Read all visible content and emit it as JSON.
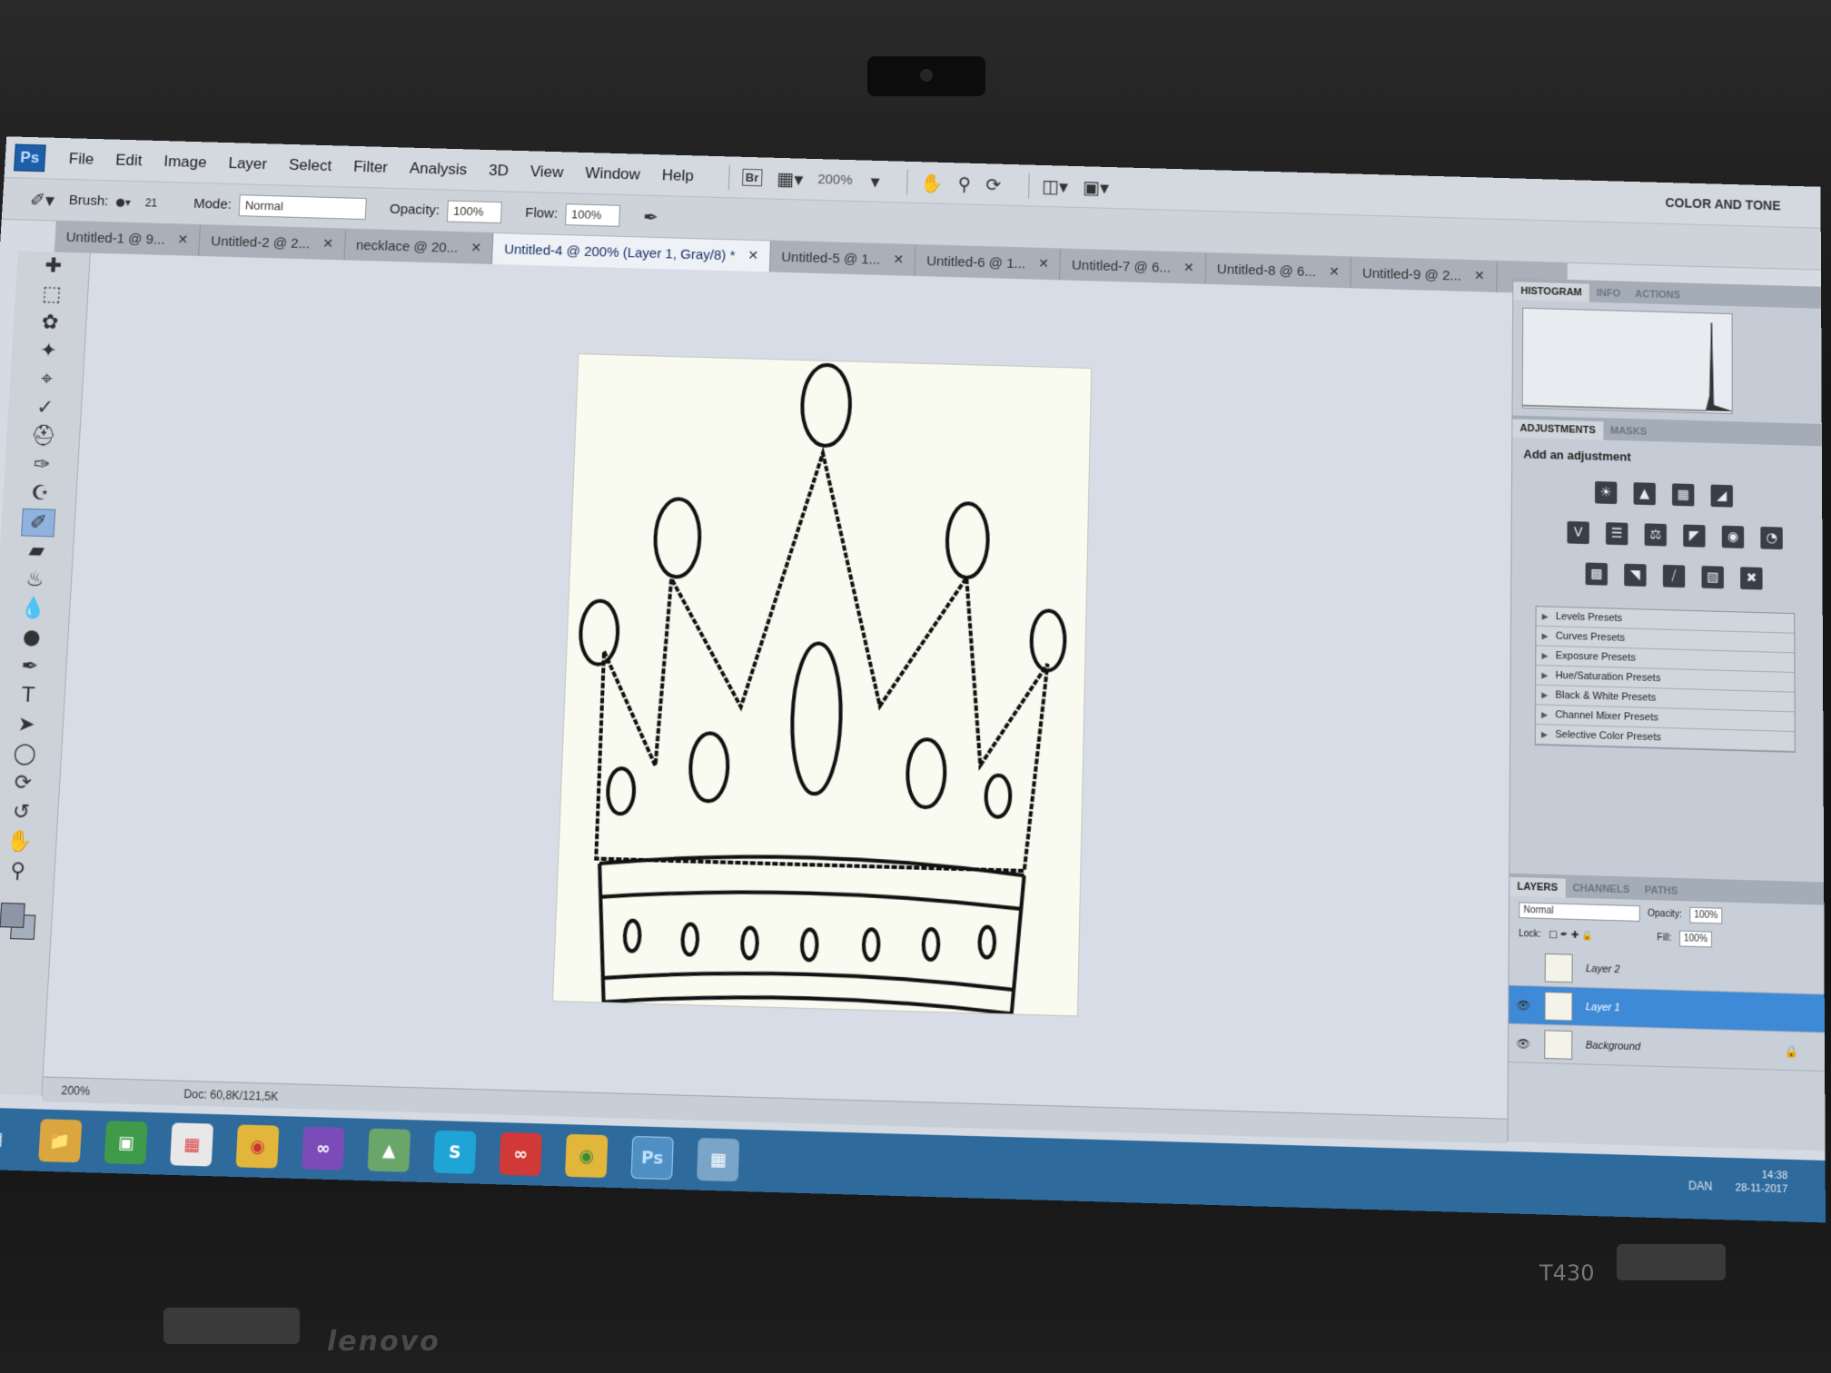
{
  "app": {
    "logo": "Ps",
    "workspace": "COLOR AND TONE"
  },
  "menu": [
    "File",
    "Edit",
    "Image",
    "Layer",
    "Select",
    "Filter",
    "Analysis",
    "3D",
    "View",
    "Window",
    "Help"
  ],
  "toolbar": {
    "bridge_label": "Br",
    "zoom": "200%"
  },
  "options": {
    "brush_label": "Brush:",
    "brush_size": "21",
    "mode_label": "Mode:",
    "mode_value": "Normal",
    "opacity_label": "Opacity:",
    "opacity_value": "100%",
    "flow_label": "Flow:",
    "flow_value": "100%"
  },
  "tabs": [
    {
      "label": "Untitled-1 @ 9...",
      "active": false
    },
    {
      "label": "Untitled-2 @ 2...",
      "active": false
    },
    {
      "label": "necklace @ 20...",
      "active": false
    },
    {
      "label": "Untitled-4 @ 200% (Layer 1, Gray/8) *",
      "active": true
    },
    {
      "label": "Untitled-5 @ 1...",
      "active": false
    },
    {
      "label": "Untitled-6 @ 1...",
      "active": false
    },
    {
      "label": "Untitled-7 @ 6...",
      "active": false
    },
    {
      "label": "Untitled-8 @ 6...",
      "active": false
    },
    {
      "label": "Untitled-9 @ 2...",
      "active": false
    }
  ],
  "tools": [
    "move",
    "marquee",
    "lasso",
    "magic-wand",
    "crop",
    "eyedropper",
    "healing",
    "brush",
    "clone-stamp",
    "history-brush",
    "eraser",
    "paint-bucket",
    "blur",
    "dodge",
    "pen",
    "type",
    "path-selection",
    "shape",
    "3d-rotate",
    "3d-orbit",
    "hand",
    "zoom"
  ],
  "selected_tool": "history-brush",
  "status": {
    "zoom": "200%",
    "doc": "Doc: 60,8K/121,5K"
  },
  "panels": {
    "top_tabs": [
      "HISTOGRAM",
      "INFO",
      "ACTIONS"
    ],
    "adj_tabs": [
      "ADJUSTMENTS",
      "MASKS"
    ],
    "adj_title": "Add an adjustment",
    "presets": [
      "Levels Presets",
      "Curves Presets",
      "Exposure Presets",
      "Hue/Saturation Presets",
      "Black & White Presets",
      "Channel Mixer Presets",
      "Selective Color Presets"
    ],
    "layer_tabs": [
      "LAYERS",
      "CHANNELS",
      "PATHS"
    ],
    "blend_mode": "Normal",
    "opacity_label": "Opacity:",
    "opacity_value": "100%",
    "lock_label": "Lock:",
    "fill_label": "Fill:",
    "fill_value": "100%",
    "layers": [
      {
        "name": "Layer 2",
        "visible": false,
        "selected": false
      },
      {
        "name": "Layer 1",
        "visible": true,
        "selected": true
      },
      {
        "name": "Background",
        "visible": true,
        "selected": false
      }
    ]
  },
  "taskbar": {
    "apps": [
      "start",
      "file-explorer",
      "store",
      "apps-grid",
      "chrome",
      "visual-studio",
      "android-studio",
      "skype",
      "creative-cloud",
      "chrome-2",
      "photoshop",
      "image-viewer"
    ],
    "active_app": "photoshop",
    "ps_label": "Ps",
    "lang": "DAN",
    "time": "14:38",
    "date": "28-11-2017"
  },
  "device": {
    "brand": "lenovo",
    "model": "T430"
  }
}
